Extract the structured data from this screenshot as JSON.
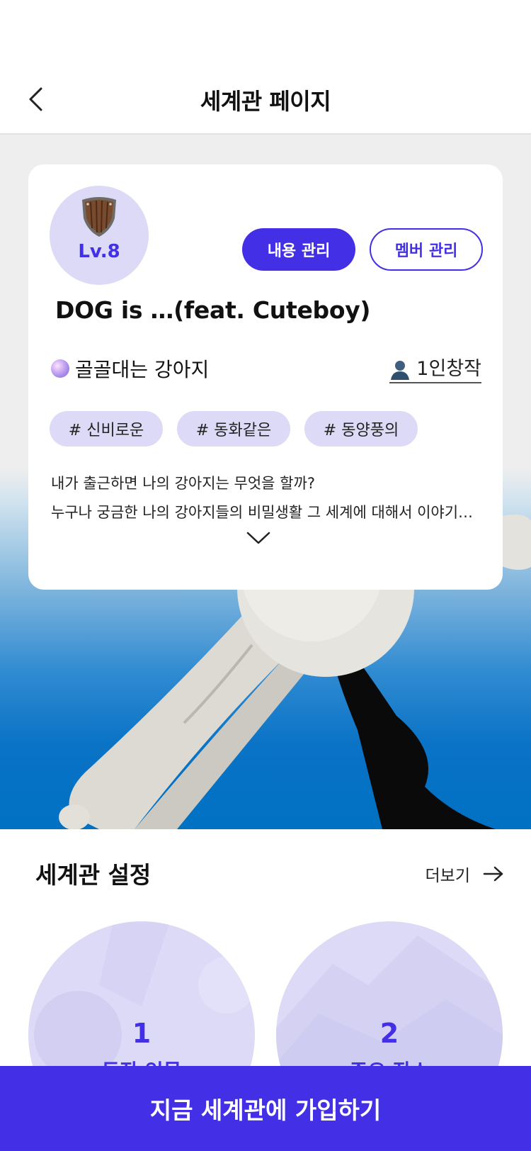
{
  "header": {
    "title": "세계관 페이지",
    "back_icon": "chevron-left-icon"
  },
  "world_card": {
    "level": "Lv.8",
    "shield_icon": "shield-icon",
    "manage_content_label": "내용 관리",
    "manage_members_label": "멤버 관리",
    "title": "DOG is …(feat. Cuteboy)",
    "creator_name": "골골대는 강아지",
    "creator_icon": "creator-orb-icon",
    "member_count_label": "1인창작",
    "member_icon": "person-icon",
    "tags": [
      "# 신비로운",
      "# 동화같은",
      "# 동양풍의"
    ],
    "description_lines": [
      "내가 출근하면 나의 강아지는 무엇을 할까?",
      "누구나 궁금한 나의 강아지들의 비밀생활 그 세계에 대해서 이야기합니다"
    ],
    "expand_icon": "chevron-down-icon"
  },
  "settings": {
    "title": "세계관 설정",
    "more_label": "더보기",
    "more_icon": "arrow-right-icon",
    "items": [
      {
        "count": "1",
        "label": "등장 인물"
      },
      {
        "count": "2",
        "label": "주요 장소"
      }
    ]
  },
  "cta": {
    "label": "지금 세계관에 가입하기"
  },
  "colors": {
    "accent": "#4330e6",
    "accent_light": "#dcdaf6",
    "hero_blue": "#0071c3"
  }
}
